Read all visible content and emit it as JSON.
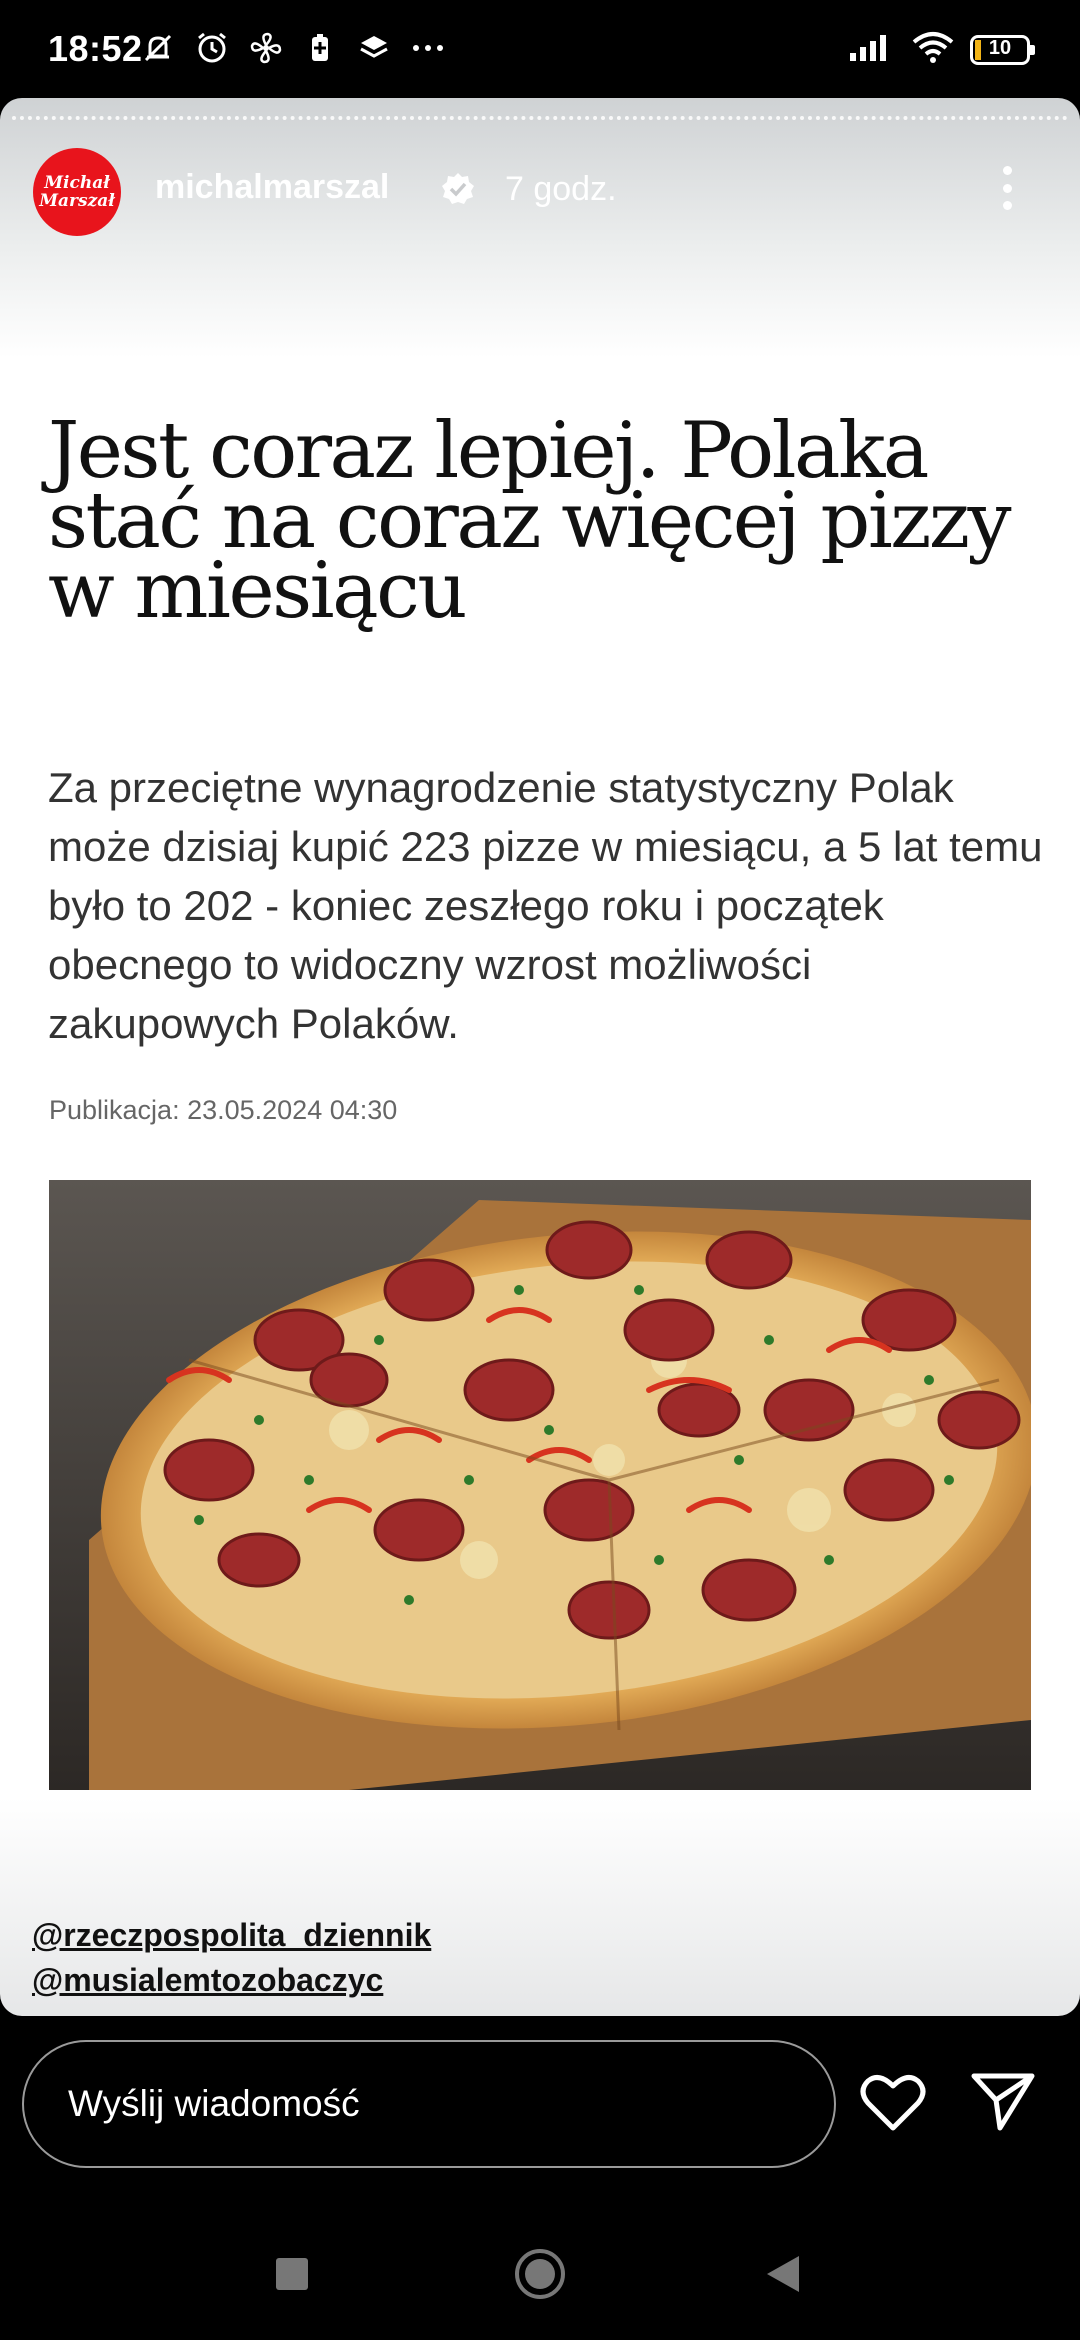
{
  "status_bar": {
    "time": "18:52",
    "battery": "10",
    "icons": [
      "mute-icon",
      "alarm-icon",
      "fan-icon",
      "battery-saver-icon",
      "layers-icon",
      "more-dots-icon",
      "signal-icon",
      "wifi-icon",
      "battery-icon"
    ]
  },
  "story": {
    "avatar_text": "Michał Marszał",
    "username": "michalmarszal",
    "time_ago": "7 godz.",
    "headline": "Jest coraz lepiej. Polaka stać na coraz więcej pizzy w miesiącu",
    "lead": "Za przeciętne wynagrodzenie statystyczny Polak może dzisiaj kupić 223 pizze w miesiącu, a 5 lat temu było to 202 - koniec zeszłego roku i początek obecnego to widoczny wzrost możliwości zakupowych Polaków.",
    "publication": "Publikacja: 23.05.2024 04:30",
    "tags": [
      "@rzeczpospolita_dziennik",
      "@musialemtozobaczyc"
    ]
  },
  "message_bar": {
    "placeholder": "Wyślij wiadomość"
  },
  "colors": {
    "accent_red": "#e8141c",
    "background": "#000000"
  }
}
